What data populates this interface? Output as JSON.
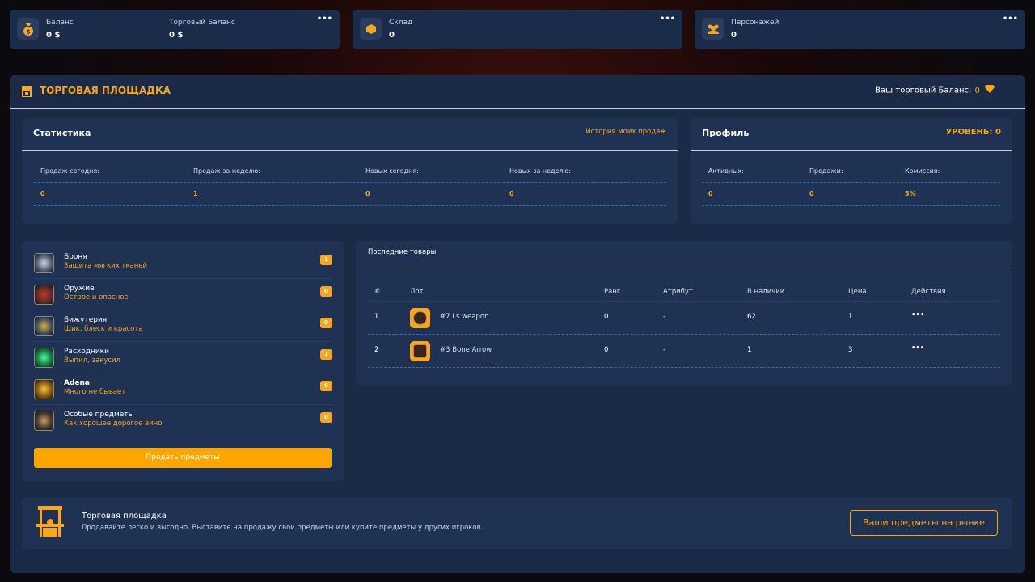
{
  "top_cards": {
    "balance_label": "Баланс",
    "balance_value": "0 $",
    "trade_balance_label": "Торговый Баланс",
    "trade_balance_value": "0 $",
    "warehouse_label": "Склад",
    "warehouse_value": "0",
    "characters_label": "Персонажей",
    "characters_value": "0",
    "dots": "•••"
  },
  "main": {
    "title": "ТОРГОВАЯ ПЛОЩАДКА",
    "balance_label": "Ваш торговый Баланс:",
    "balance_value": "0"
  },
  "stats": {
    "title": "Статистика",
    "history_link": "История моих продаж",
    "headers": [
      "Продаж сегодня:",
      "Продаж за неделю:",
      "Новых сегодня:",
      "Новых за неделю:"
    ],
    "values": [
      "0",
      "1",
      "0",
      "0"
    ]
  },
  "profile": {
    "title": "Профиль",
    "level": "УРОВЕНЬ: 0",
    "headers": [
      "Активных:",
      "Продажи:",
      "Комиссия:"
    ],
    "values": [
      "0",
      "0",
      "5%"
    ]
  },
  "categories": [
    {
      "name": "Броня",
      "sub": "Защита мягких тканей",
      "count": "1"
    },
    {
      "name": "Оружие",
      "sub": "Острое и опасное",
      "count": "0"
    },
    {
      "name": "Бижутерия",
      "sub": "Шик, блеск и красота",
      "count": "0"
    },
    {
      "name": "Расходники",
      "sub": "Выпил, закусил",
      "count": "1"
    },
    {
      "name": "Adena",
      "sub": "Много не бывает",
      "count": "0"
    },
    {
      "name": "Особые предметы",
      "sub": "Как хорошее дорогое вино",
      "count": "0"
    }
  ],
  "sell_button": "Продать предметы",
  "latest": {
    "title": "Последние товары",
    "headers": [
      "#",
      "Лот",
      "Ранг",
      "Атрибут",
      "В наличии",
      "Цена",
      "Действия"
    ],
    "rows": [
      {
        "num": "1",
        "lot": "#7 Ls weapon",
        "rank": "0",
        "attr": "-",
        "stock": "62",
        "price": "1",
        "actions": "•••"
      },
      {
        "num": "2",
        "lot": "#3 Bone Arrow",
        "rank": "0",
        "attr": "-",
        "stock": "1",
        "price": "3",
        "actions": "•••"
      }
    ]
  },
  "footer": {
    "title": "Торговая площадка",
    "desc": "Продавайте легко и выгодно. Выставите на продажу свои предметы или купите предметы у других игроков.",
    "button": "Ваши предметы на рынке"
  },
  "colors": {
    "accent": "#f5a623",
    "panel": "#1f3254",
    "main_bg": "#1a2a47"
  }
}
